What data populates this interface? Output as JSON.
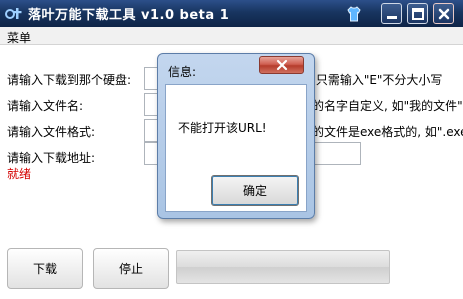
{
  "window": {
    "title": "落叶万能下载工具 v1.0 beta 1"
  },
  "menu": {
    "items": [
      "菜单"
    ]
  },
  "form": {
    "drive_label": "请输入下载到那个硬盘:",
    "filename_label": "请输入文件名:",
    "format_label": "请输入文件格式:",
    "url_label": "请输入下载地址:",
    "drive_value": "",
    "filename_value": "",
    "format_value": "",
    "url_value": "",
    "drive_hint": ",只需输入\"E\"不分大小写",
    "filename_hint": "的名字自定义, 如\"我的文件\"",
    "format_hint": "的文件是exe格式的, 如\".exe\""
  },
  "status": {
    "text": "就绪",
    "color": "#d40000"
  },
  "buttons": {
    "download_label": "下载",
    "stop_label": "停止"
  },
  "progress": {
    "value": 0
  },
  "dialog": {
    "title": "信息:",
    "message": "不能打开该URL!",
    "ok_label": "确定"
  },
  "icons": {
    "app": "app-logo-icon",
    "skin": "shirt-icon",
    "minimize": "minimize-icon",
    "maximize": "maximize-icon",
    "close": "close-icon",
    "dialog_close": "close-icon"
  },
  "colors": {
    "titlebar": "#183560",
    "dialog_frame": "#a9c4e4",
    "dialog_close": "#c4493a",
    "status_text": "#d40000"
  }
}
